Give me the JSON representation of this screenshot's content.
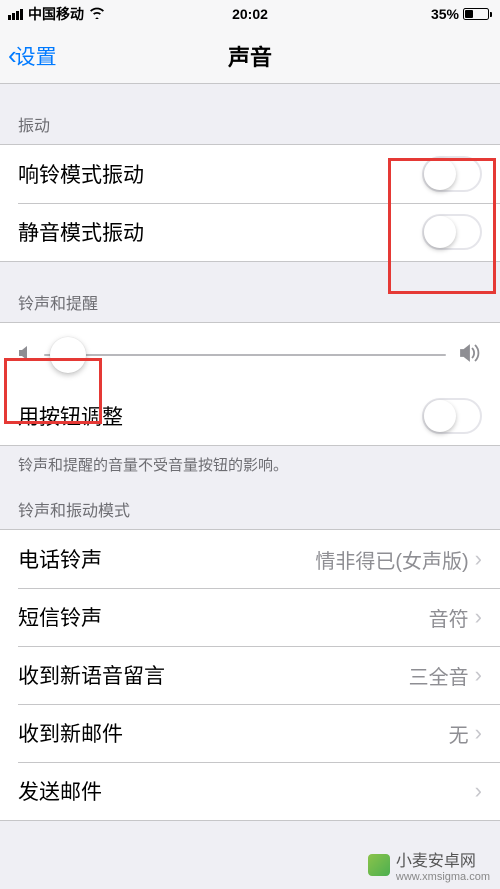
{
  "status": {
    "carrier": "中国移动",
    "time": "20:02",
    "battery_percent": "35%"
  },
  "nav": {
    "back_label": "设置",
    "title": "声音"
  },
  "sections": {
    "vibrate": {
      "header": "振动",
      "ring_vibrate": "响铃模式振动",
      "silent_vibrate": "静音模式振动"
    },
    "ringer": {
      "header": "铃声和提醒",
      "button_adjust": "用按钮调整",
      "footer": "铃声和提醒的音量不受音量按钮的影响。"
    },
    "tones": {
      "header": "铃声和振动模式",
      "ringtone": {
        "label": "电话铃声",
        "value": "情非得已(女声版)"
      },
      "text_tone": {
        "label": "短信铃声",
        "value": "音符"
      },
      "voicemail": {
        "label": "收到新语音留言",
        "value": "三全音"
      },
      "new_mail": {
        "label": "收到新邮件",
        "value": "无"
      },
      "sent_mail": {
        "label": "发送邮件",
        "value": ""
      }
    }
  },
  "watermark": {
    "text": "小麦安卓网",
    "url": "www.xmsigma.com"
  }
}
